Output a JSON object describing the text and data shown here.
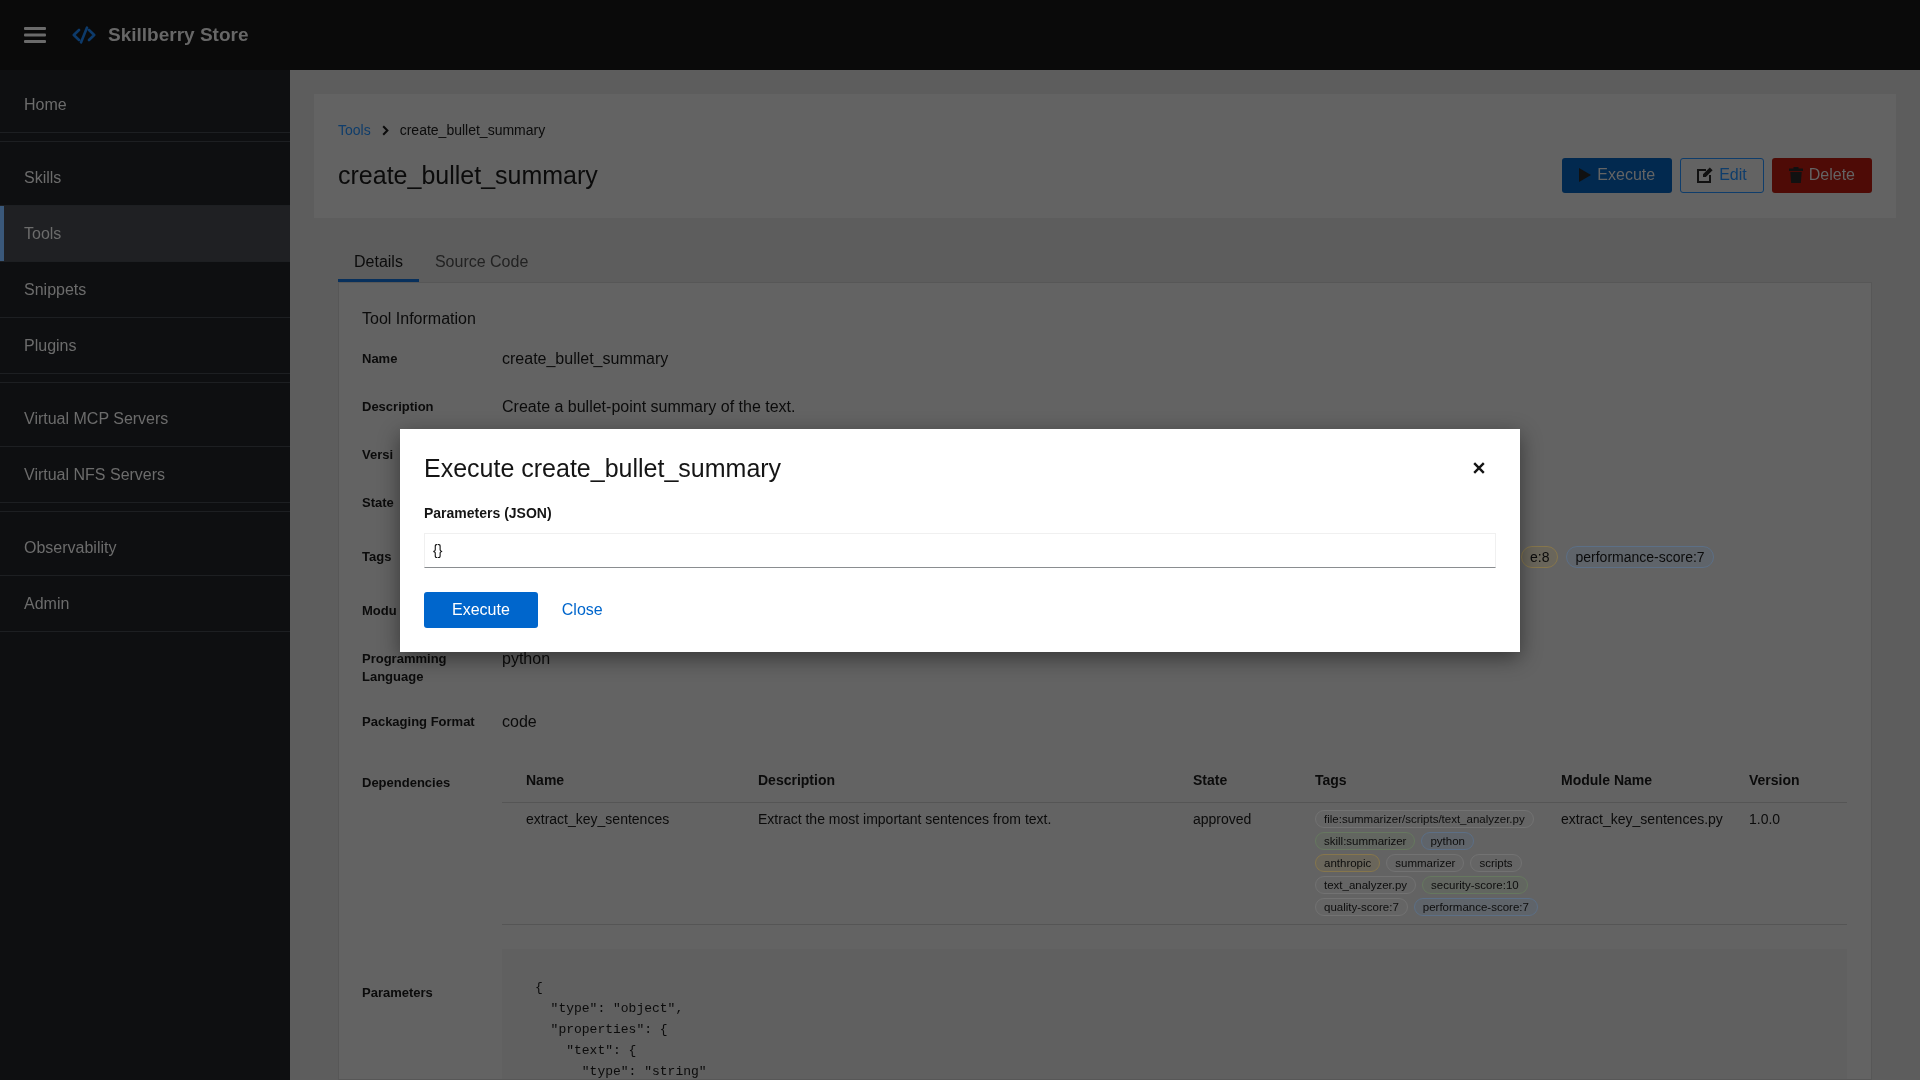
{
  "top_bar": {
    "title": "Skillberry Store"
  },
  "sidebar": {
    "groups": [
      {
        "items": [
          {
            "label": "Home",
            "selected": false
          }
        ]
      },
      {
        "items": [
          {
            "label": "Skills",
            "selected": false
          },
          {
            "label": "Tools",
            "selected": true
          },
          {
            "label": "Snippets",
            "selected": false
          },
          {
            "label": "Plugins",
            "selected": false
          }
        ]
      },
      {
        "items": [
          {
            "label": "Virtual MCP Servers",
            "selected": false
          },
          {
            "label": "Virtual NFS Servers",
            "selected": false
          }
        ]
      },
      {
        "items": [
          {
            "label": "Observability",
            "selected": false
          },
          {
            "label": "Admin",
            "selected": false
          }
        ]
      }
    ]
  },
  "breadcrumb": [
    {
      "label": "Tools",
      "kind": "link"
    },
    {
      "label": "create_bullet_summary",
      "kind": "current"
    }
  ],
  "page_title": "create_bullet_summary",
  "actions": [
    {
      "label": "Execute",
      "kind": "primary"
    },
    {
      "label": "Edit",
      "kind": "secondary"
    },
    {
      "label": "Delete",
      "kind": "danger"
    }
  ],
  "tabs": [
    {
      "label": "Details",
      "selected": true
    },
    {
      "label": "Source Code",
      "selected": false
    }
  ],
  "details": {
    "title": "Tool Information",
    "rows": [
      {
        "label": "Name",
        "kind": "text",
        "value": "create_bullet_summary"
      },
      {
        "label": "Description",
        "kind": "text",
        "value": "Create a bullet-point summary of the text."
      },
      {
        "label": "Versi"
      },
      {
        "label": "State"
      },
      {
        "label": "Tags",
        "kind": "tags",
        "tags": [
          {
            "label": "e:8",
            "color": "#86764c"
          },
          {
            "label": "performance-score:7",
            "color": "#5c6f86"
          }
        ]
      },
      {
        "label": "Modu"
      },
      {
        "label": "Programming Language",
        "kind": "text",
        "value": "python"
      },
      {
        "label": "Packaging Format",
        "kind": "text",
        "value": "code"
      },
      {
        "label": "Dependencies",
        "kind": "table",
        "columns": [
          "Name",
          "Description",
          "State",
          "Tags",
          "Module Name",
          "Version"
        ],
        "rows": [
          {
            "cells": [
              {
                "kind": "text",
                "text": "extract_key_sentences"
              },
              {
                "kind": "text",
                "text": "Extract the most important sentences from text."
              },
              {
                "kind": "text",
                "text": "approved"
              },
              {
                "kind": "tags",
                "tags": [
                  {
                    "label": "file:summarizer/scripts/text_analyzer.py",
                    "color": "#727272"
                  },
                  {
                    "label": "skill:summarizer",
                    "color": "#66785f"
                  },
                  {
                    "label": "python",
                    "color": "#5c6f86"
                  },
                  {
                    "label": "anthropic",
                    "color": "#86764c"
                  },
                  {
                    "label": "summarizer",
                    "color": "#727272"
                  },
                  {
                    "label": "scripts",
                    "color": "#727272"
                  },
                  {
                    "label": "text_analyzer.py",
                    "color": "#727272"
                  },
                  {
                    "label": "security-score:10",
                    "color": "#66785f"
                  },
                  {
                    "label": "quality-score:7",
                    "color": "#727272"
                  },
                  {
                    "label": "performance-score:7",
                    "color": "#5c6f86"
                  }
                ]
              },
              {
                "kind": "text",
                "text": "extract_key_sentences.py"
              },
              {
                "kind": "text",
                "text": "1.0.0"
              }
            ]
          }
        ]
      },
      {
        "label": "Parameters",
        "kind": "code",
        "lines": [
          "{",
          "  \"type\": \"object\",",
          "  \"properties\": {",
          "    \"text\": {",
          "      \"type\": \"string\""
        ]
      }
    ]
  },
  "modal": {
    "title": "Execute create_bullet_summary",
    "field": {
      "label": "Parameters (JSON)",
      "value": "{}"
    },
    "buttons": [
      {
        "label": "Execute",
        "kind": "primary"
      },
      {
        "label": "Close",
        "kind": "link"
      }
    ]
  }
}
